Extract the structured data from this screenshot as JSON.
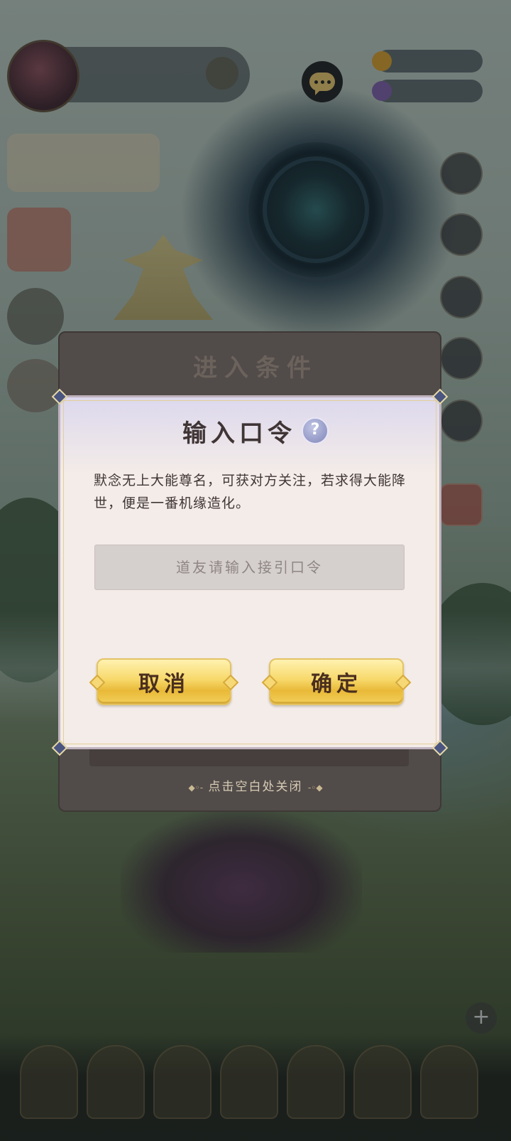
{
  "dialog": {
    "title": "输入口令",
    "help_icon": "question-mark",
    "description": "默念无上大能尊名，可获对方关注，若求得大能降世，便是一番机缘造化。",
    "input": {
      "value": "",
      "placeholder": "道友请输入接引口令"
    },
    "cancel_label": "取消",
    "confirm_label": "确定"
  },
  "back_panel": {
    "title": "进入条件",
    "close_hint": "点击空白处关闭",
    "close_hint_left_deco": "◆◦-",
    "close_hint_right_deco": "-◦◆"
  },
  "colors": {
    "dialog_bg": "#f4ece8",
    "button_gold": "#f7d86a",
    "title_text": "#3f3535",
    "help_icon": "#7f86b8"
  }
}
